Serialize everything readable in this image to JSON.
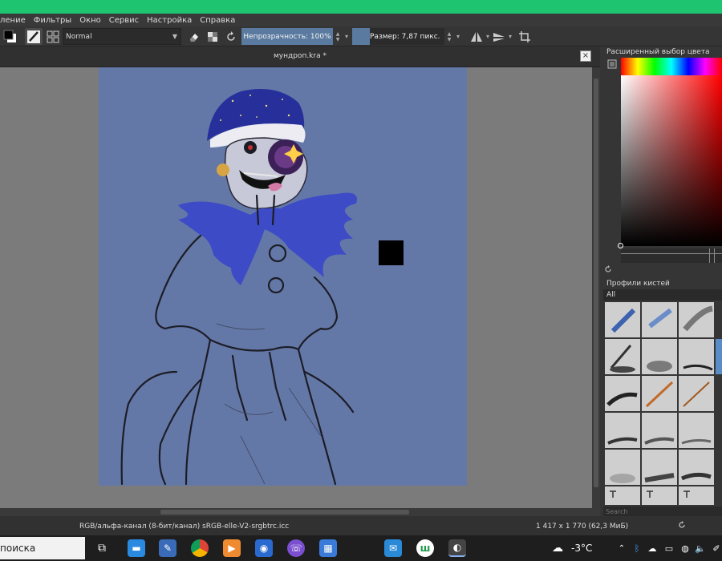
{
  "menu": [
    "ление",
    "Фильтры",
    "Окно",
    "Сервис",
    "Настройка",
    "Справка"
  ],
  "toolbar": {
    "blend_mode": "Normal",
    "opacity_label": "Непрозрачность: 100%",
    "size_label": "Размер: 7,87 пикс."
  },
  "document": {
    "title": "мундроп.kra *",
    "close_glyph": "×"
  },
  "panels": {
    "color_selector_title": "Расширенный выбор цвета",
    "brush_presets_title": "Профили кистей",
    "brush_filter": "All",
    "search_placeholder": "Search"
  },
  "status": {
    "color_profile": "RGB/альфа-канал (8-бит/канал)  sRGB-elle-V2-srgbtrc.icc",
    "image_size": "1 417 x 1 770 (62,3 МиБ)"
  },
  "taskbar": {
    "search_text": "поиска",
    "temperature": "-3°C"
  },
  "colors": {
    "accent_green": "#1ec46f",
    "canvas_blue": "#6478a8",
    "active_blue": "#5a7aa0"
  }
}
